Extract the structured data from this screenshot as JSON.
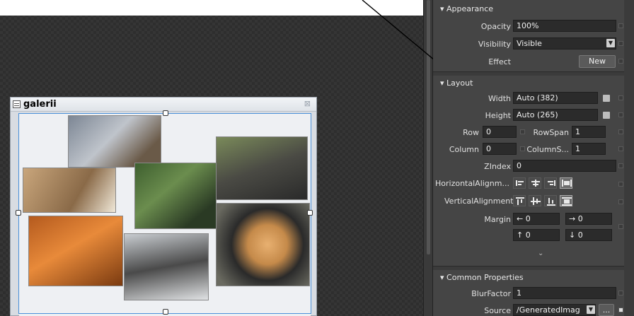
{
  "window": {
    "title": "galerii",
    "close_glyph": "⊠"
  },
  "panel": {
    "appearance": {
      "header": "Appearance",
      "opacity_label": "Opacity",
      "opacity_value": "100%",
      "visibility_label": "Visibility",
      "visibility_value": "Visible",
      "effect_label": "Effect",
      "effect_button": "New"
    },
    "layout": {
      "header": "Layout",
      "width_label": "Width",
      "width_value": "Auto (382)",
      "height_label": "Height",
      "height_value": "Auto (265)",
      "row_label": "Row",
      "row_value": "0",
      "rowspan_label": "RowSpan",
      "rowspan_value": "1",
      "column_label": "Column",
      "column_value": "0",
      "columnspan_label": "ColumnS...",
      "columnspan_value": "1",
      "zindex_label": "ZIndex",
      "zindex_value": "0",
      "halign_label": "HorizontalAlignm...",
      "valign_label": "VerticalAlignment",
      "margin_label": "Margin",
      "margin_left": "0",
      "margin_right": "0",
      "margin_top": "0",
      "margin_bottom": "0"
    },
    "common": {
      "header": "Common Properties",
      "blur_label": "BlurFactor",
      "blur_value": "1",
      "source_label": "Source",
      "source_value": "/GeneratedImag",
      "source_button": "..."
    }
  },
  "colors": {
    "panel_bg": "#3b3b3b",
    "section_bg": "#454545",
    "field_bg": "#2b2b2b",
    "selection": "#4a90d9"
  },
  "icons": [
    "window-menu-icon",
    "close-icon",
    "expand-icon",
    "arrow-down-icon",
    "combo-arrow-icon"
  ]
}
